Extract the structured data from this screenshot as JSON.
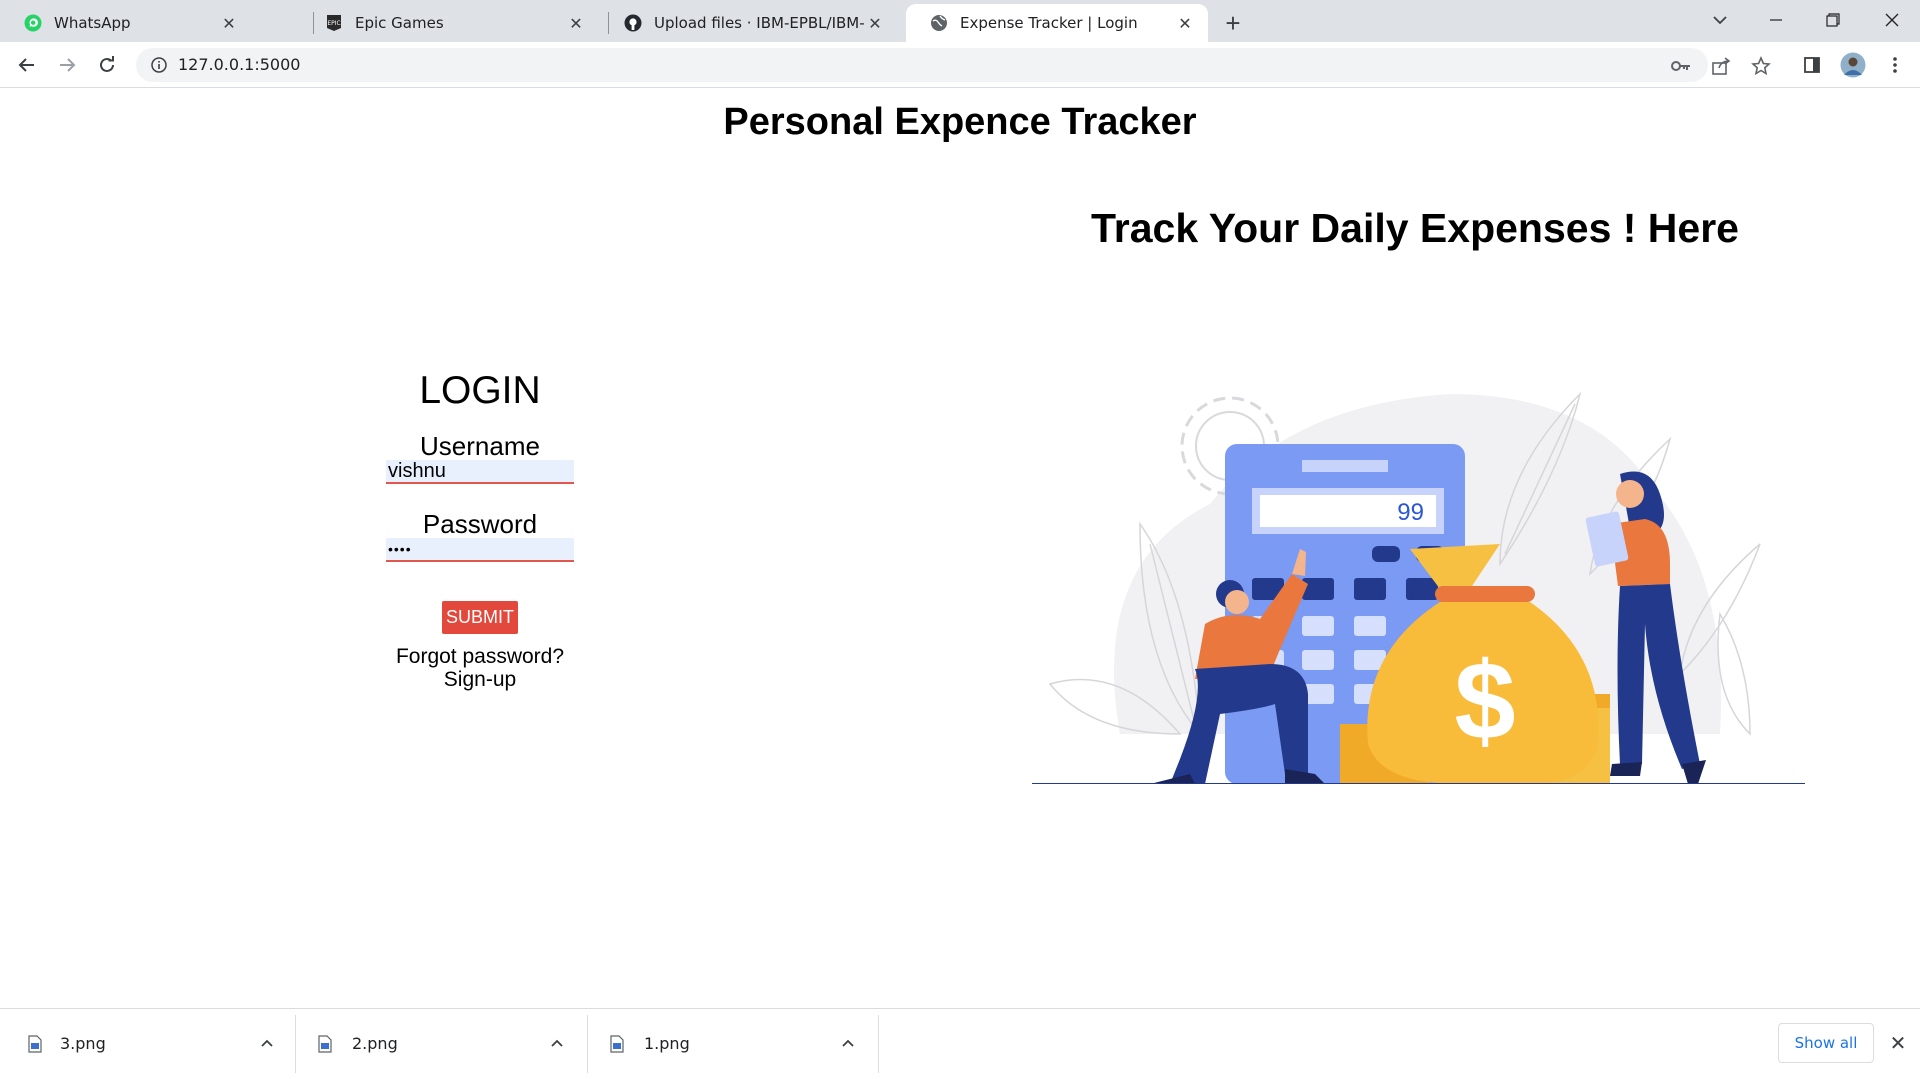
{
  "tabs": [
    {
      "title": "WhatsApp",
      "icon": "whatsapp-icon"
    },
    {
      "title": "Epic Games",
      "icon": "epic-games-icon"
    },
    {
      "title": "Upload files · IBM-EPBL/IBM-Proj",
      "icon": "github-icon"
    },
    {
      "title": "Expense Tracker | Login",
      "icon": "globe-icon",
      "active": true
    }
  ],
  "address_bar": {
    "url": "127.0.0.1:5000"
  },
  "page": {
    "title": "Personal Expence Tracker",
    "tagline": "Track Your Daily Expenses ! Here",
    "login": {
      "heading": "LOGIN",
      "username_label": "Username",
      "username_value": "vishnu",
      "password_label": "Password",
      "password_value": "••••",
      "submit_label": "SUBMIT",
      "forgot_label": "Forgot password?",
      "signup_label": "Sign-up"
    },
    "illustration": {
      "calculator_display": "99"
    }
  },
  "downloads": {
    "items": [
      {
        "name": "3.png"
      },
      {
        "name": "2.png"
      },
      {
        "name": "1.png"
      }
    ],
    "show_all_label": "Show all"
  },
  "colors": {
    "accent": "#e2483b",
    "calculator": "#7b9af3",
    "money_bag": "#f9bb3a",
    "figure_shirt": "#e9773e",
    "figure_pants": "#233a8c"
  }
}
